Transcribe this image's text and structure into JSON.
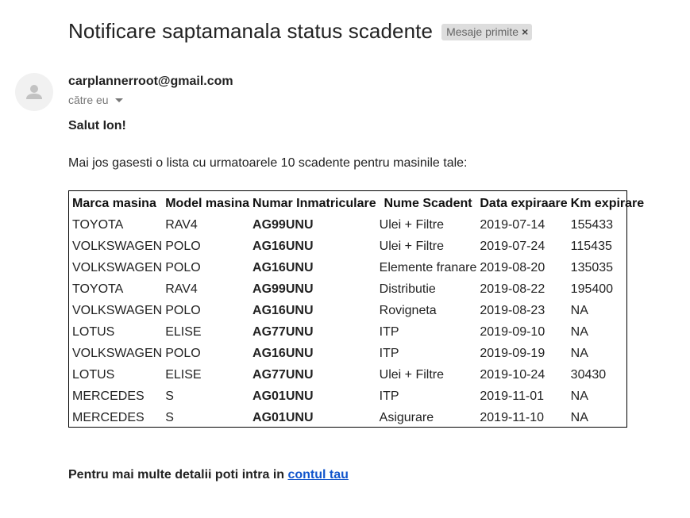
{
  "email": {
    "subject": "Notificare saptamanala status scadente",
    "label": {
      "text": "Mesaje primite",
      "close_glyph": "×"
    },
    "sender": "carplannerroot@gmail.com",
    "recipient": "către eu",
    "avatar_icon": "person-icon",
    "greeting": "Salut Ion!",
    "intro": "Mai jos gasesti o lista cu urmatoarele 10 scadente pentru masinile tale:",
    "table": {
      "headers": [
        "Marca masina",
        "Model masina",
        "Numar Inmatriculare",
        "Nume Scadent",
        "Data expiraare",
        "Km expirare"
      ],
      "rows": [
        [
          "TOYOTA",
          "RAV4",
          "AG99UNU",
          "Ulei + Filtre",
          "2019-07-14",
          "155433"
        ],
        [
          "VOLKSWAGEN",
          "POLO",
          "AG16UNU",
          "Ulei + Filtre",
          "2019-07-24",
          "115435"
        ],
        [
          "VOLKSWAGEN",
          "POLO",
          "AG16UNU",
          "Elemente franare",
          "2019-08-20",
          "135035"
        ],
        [
          "TOYOTA",
          "RAV4",
          "AG99UNU",
          "Distributie",
          "2019-08-22",
          "195400"
        ],
        [
          "VOLKSWAGEN",
          "POLO",
          "AG16UNU",
          "Rovigneta",
          "2019-08-23",
          "NA"
        ],
        [
          "LOTUS",
          "ELISE",
          "AG77UNU",
          "ITP",
          "2019-09-10",
          "NA"
        ],
        [
          "VOLKSWAGEN",
          "POLO",
          "AG16UNU",
          "ITP",
          "2019-09-19",
          "NA"
        ],
        [
          "LOTUS",
          "ELISE",
          "AG77UNU",
          "Ulei + Filtre",
          "2019-10-24",
          "30430"
        ],
        [
          "MERCEDES",
          "S",
          "AG01UNU",
          "ITP",
          "2019-11-01",
          "NA"
        ],
        [
          "MERCEDES",
          "S",
          "AG01UNU",
          "Asigurare",
          "2019-11-10",
          "NA"
        ]
      ]
    },
    "footer": {
      "text": "Pentru mai multe detalii poti intra in ",
      "link_text": "contul tau"
    }
  },
  "colors": {
    "link": "#1155cc",
    "label_bg": "#dddddd",
    "text": "#222222",
    "muted": "#777777"
  }
}
